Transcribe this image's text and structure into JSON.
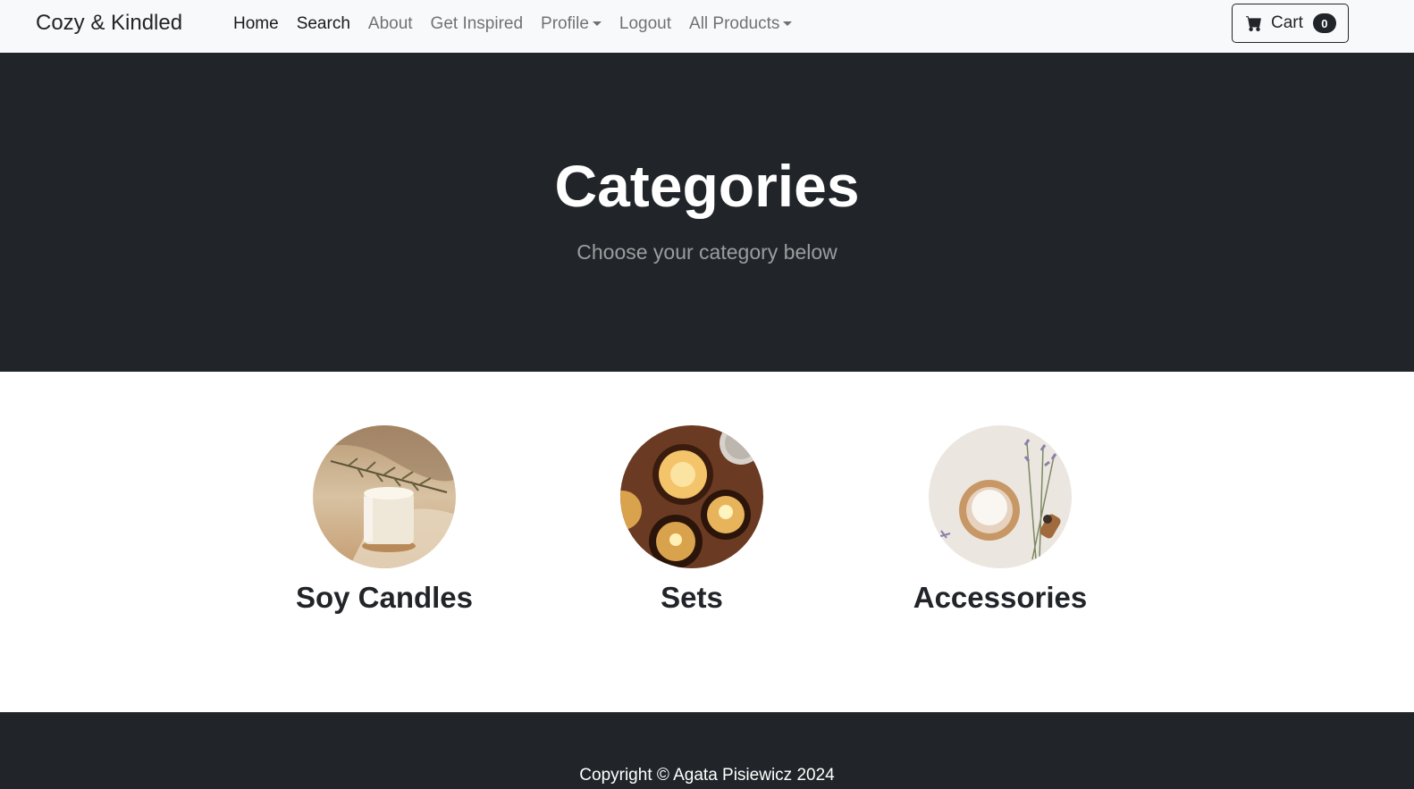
{
  "navbar": {
    "brand": "Cozy & Kindled",
    "links": [
      {
        "label": "Home"
      },
      {
        "label": "Search"
      },
      {
        "label": "About"
      },
      {
        "label": "Get Inspired"
      },
      {
        "label": "Profile"
      },
      {
        "label": "Logout"
      },
      {
        "label": "All Products"
      }
    ],
    "cart": {
      "label": "Cart",
      "count": "0",
      "icon": "cart-icon"
    }
  },
  "hero": {
    "title": "Categories",
    "subtitle": "Choose your category below"
  },
  "categories": [
    {
      "name": "Soy Candles"
    },
    {
      "name": "Sets"
    },
    {
      "name": "Accessories"
    }
  ],
  "footer": {
    "copyright": "Copyright © Agata Pisiewicz 2024"
  },
  "colors": {
    "dark": "#212529",
    "navbar_bg": "#f8f9fa",
    "text_muted": "#6c757d"
  }
}
